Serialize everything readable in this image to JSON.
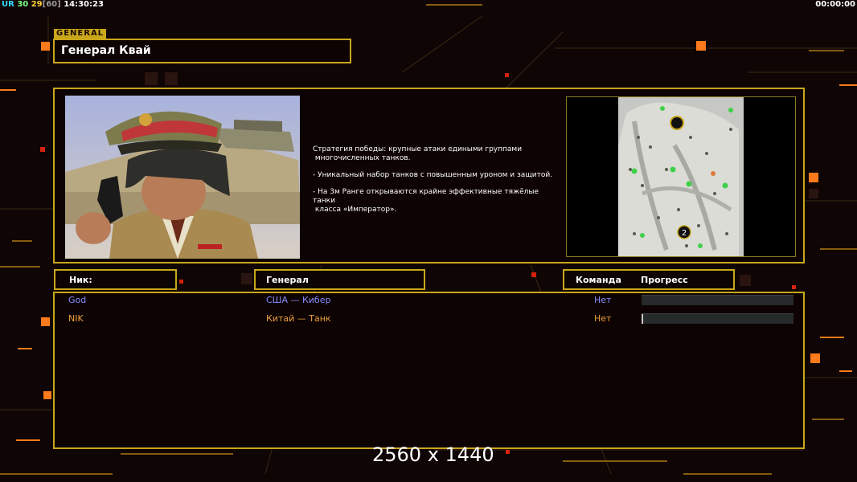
{
  "hud": {
    "ur_label": "UR",
    "fps": "30",
    "frames": "29",
    "frames_cap": "[60]",
    "clock": "14:30:23",
    "timer": "00:00:00"
  },
  "general": {
    "tag": "GENERAL",
    "name": "Генерал Квай",
    "description": [
      "Стратегия победы: крупные атаки едиными группами\n многочисленных танков.",
      "- Уникальный набор танков с повышенным уроном и защитой.",
      "- На 3м Ранге открываются крайне эффективные тяжёлые танки\n класса «Император»."
    ]
  },
  "table": {
    "col_nick": "Ник:",
    "col_general": "Генерал",
    "col_team": "Команда",
    "col_progress": "Прогресс",
    "rows": [
      {
        "nick": "God",
        "general": "США — Кибер",
        "team": "Нет",
        "color": "#8a8cff",
        "progress": 0
      },
      {
        "nick": "NIK",
        "general": "Китай — Танк",
        "team": "Нет",
        "color": "#f0a03c",
        "progress": 0.01
      }
    ]
  },
  "watermark": "2560 x 1440",
  "colors": {
    "gold": "#c9a61a",
    "accent_orange": "#ff7a1a",
    "background": "#0f0505"
  }
}
